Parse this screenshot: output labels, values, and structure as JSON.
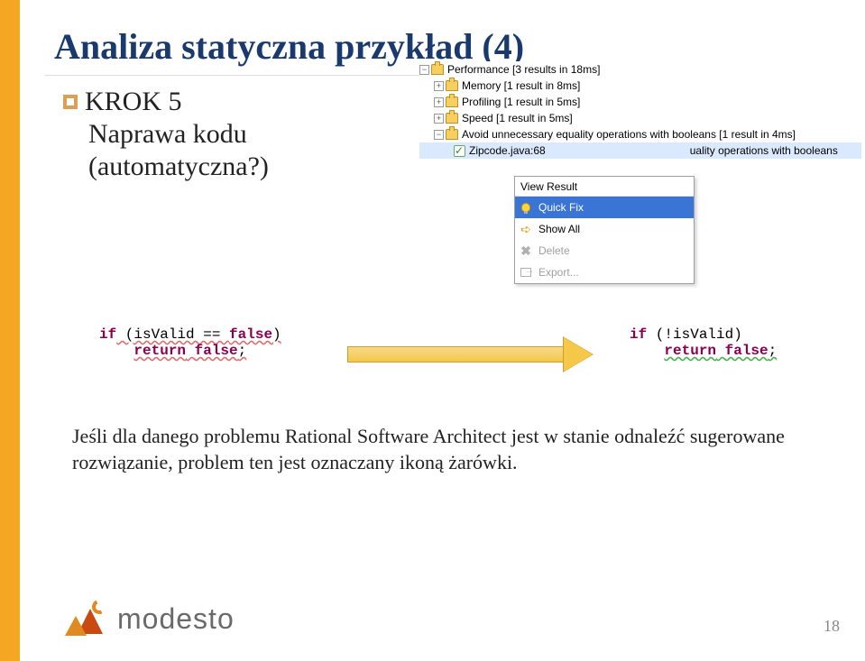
{
  "title": "Analiza statyczna przykład (4)",
  "step_label": "KROK 5",
  "step_sub1": "Naprawa kodu",
  "step_sub2": "(automatyczna?)",
  "tree": {
    "performance": "Performance [3 results in 18ms]",
    "memory": "Memory [1 result in 8ms]",
    "profiling": "Profiling [1 result in 5ms]",
    "speed": "Speed [1 result in 5ms]",
    "avoid": "Avoid unnecessary equality operations with booleans [1 result in 4ms]",
    "zipcode": "Zipcode.java:68",
    "zipcode_right": "uality operations with booleans"
  },
  "menu": {
    "title": "View Result",
    "quickfix": "Quick Fix",
    "showall": "Show All",
    "delete": "Delete",
    "export": "Export..."
  },
  "code_left": {
    "line1_kw": "if",
    "line1_rest": " (isValid == ",
    "line1_false": "false",
    "line1_end": ")",
    "line2_indent": "    ",
    "line2_kw": "return",
    "line2_rest": " ",
    "line2_false": "false",
    "line2_end": ";"
  },
  "code_right": {
    "line1_kw": "if",
    "line1_rest": " (!isValid)",
    "line2_indent": "    ",
    "line2_kw": "return",
    "line2_rest": " ",
    "line2_false": "false",
    "line2_end": ";"
  },
  "body_text": "Jeśli dla danego problemu Rational Software Architect jest w stanie odnaleźć sugerowane rozwiązanie, problem ten jest oznaczany ikoną żarówki.",
  "logo_text": "modesto",
  "page_num": "18"
}
